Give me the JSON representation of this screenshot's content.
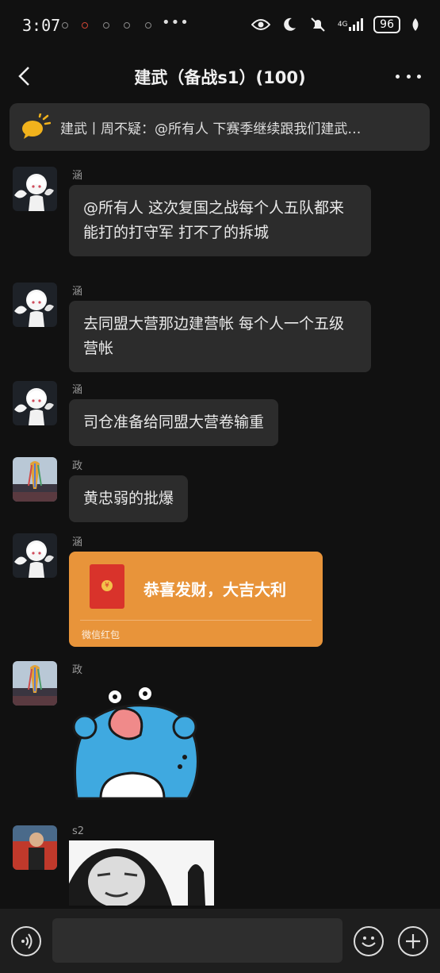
{
  "status_bar": {
    "time": "3:07",
    "network": "4G",
    "battery": "96"
  },
  "header": {
    "title": "建武（备战s1）(100)"
  },
  "announcement": {
    "text": "建武丨周不疑：@所有人 下赛季继续跟我们建武…"
  },
  "messages": [
    {
      "sender": "涵",
      "text": "@所有人  这次复国之战每个人五队都来  能打的打守军 打不了的拆城"
    },
    {
      "sender": "涵",
      "text": "去同盟大营那边建营帐 每个人一个五级营帐"
    },
    {
      "sender": "涵",
      "text": "司仓准备给同盟大营卷输重"
    },
    {
      "sender": "政",
      "text": "黄忠弱的批爆"
    },
    {
      "sender": "涵",
      "red_packet": {
        "title": "恭喜发财，大吉大利",
        "footer": "微信红包"
      }
    },
    {
      "sender": "政",
      "sticker": "blue-dinosaur-sticker"
    },
    {
      "sender": "s2",
      "sticker": "panda-meme-sticker"
    }
  ],
  "input": {
    "placeholder": ""
  },
  "colors": {
    "background": "#111111",
    "bubble": "#2c2c2c",
    "red_packet": "#e8943a",
    "announcement_bg": "#2d2d2d"
  }
}
